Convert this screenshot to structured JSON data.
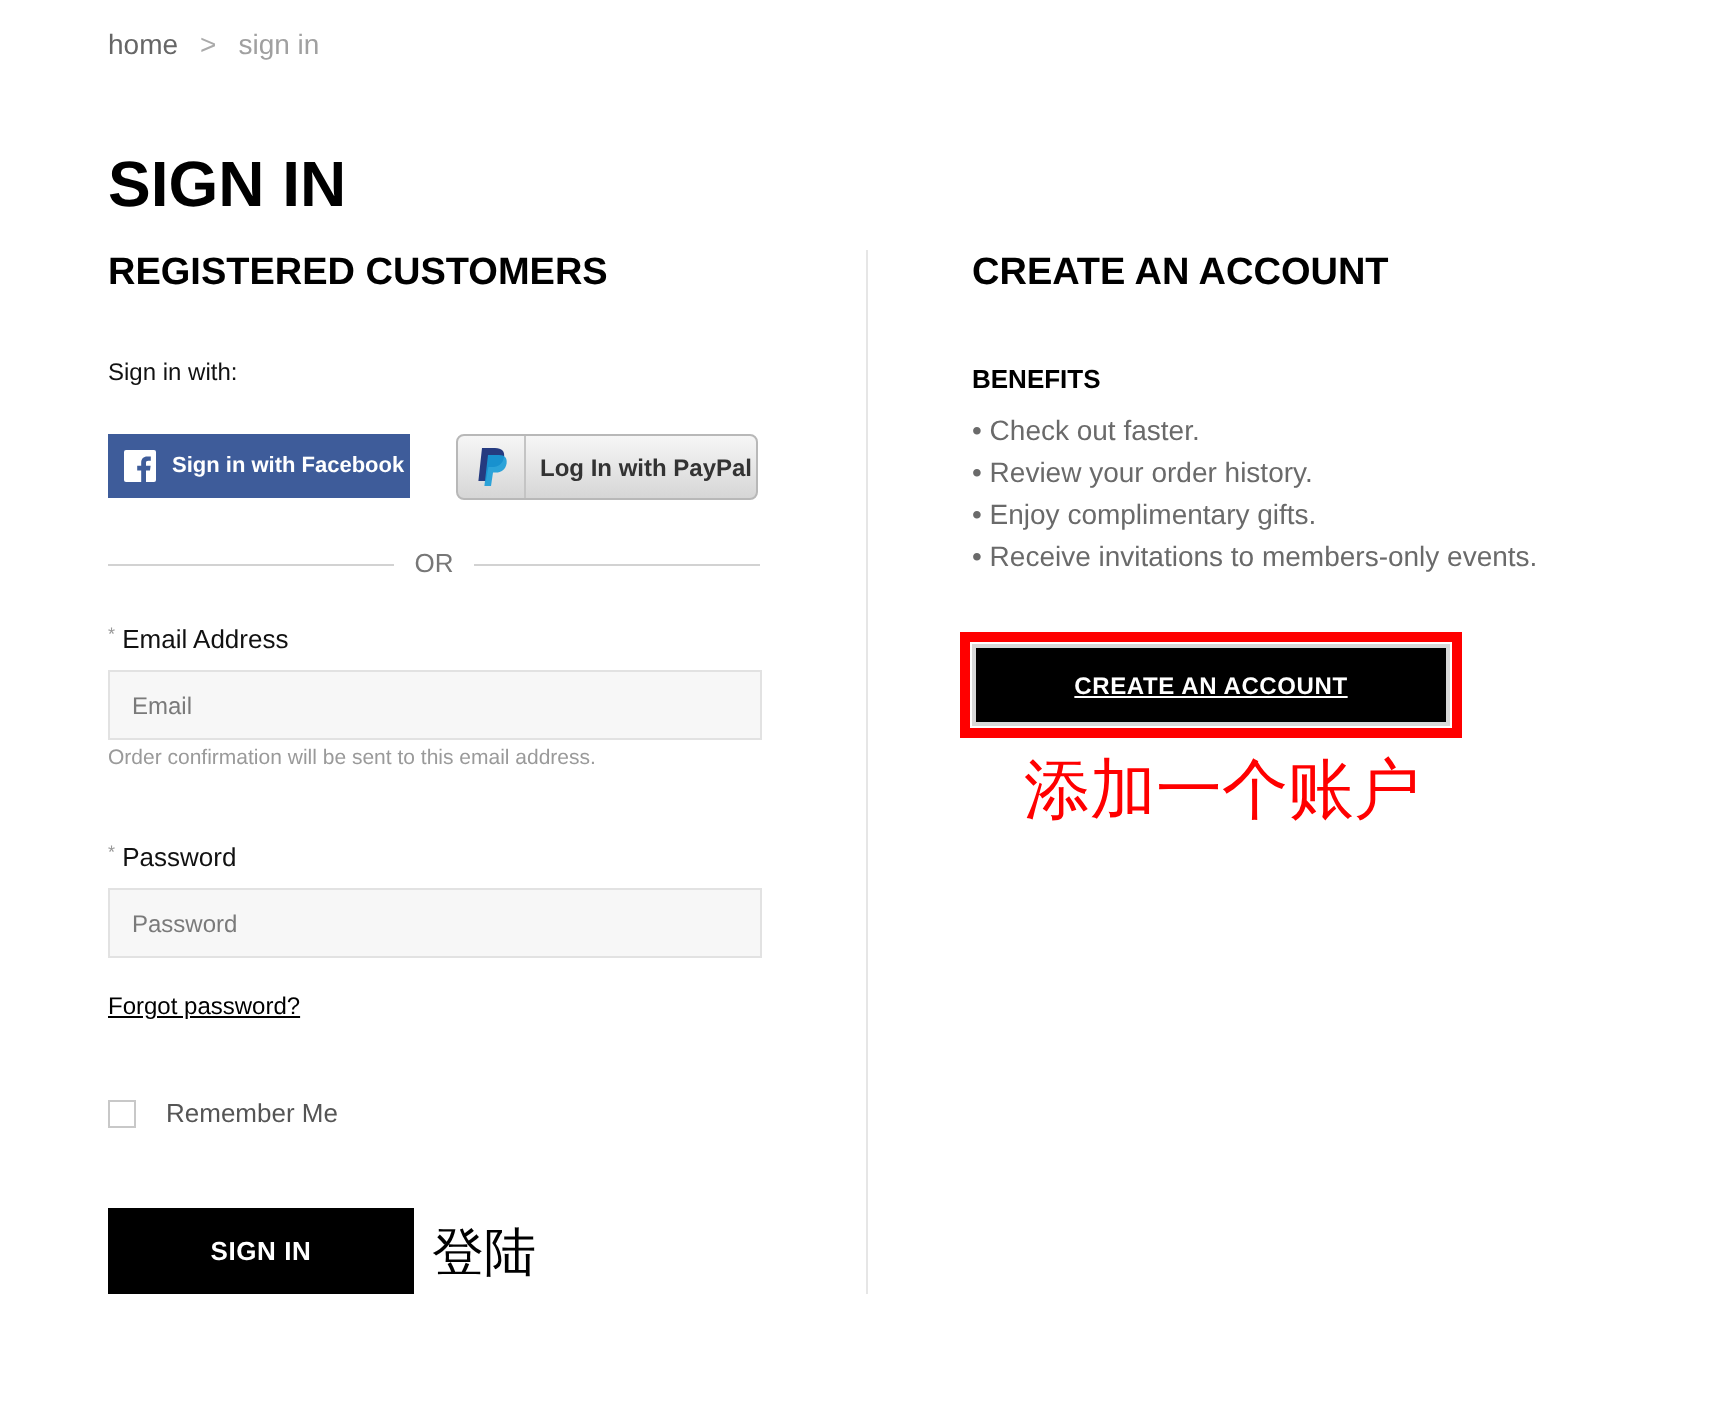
{
  "breadcrumb": {
    "separator": ">",
    "items": [
      {
        "label": "home",
        "current": false
      },
      {
        "label": "sign in",
        "current": true
      }
    ]
  },
  "page_title": "SIGN IN",
  "sign_in": {
    "heading": "REGISTERED CUSTOMERS",
    "social_label": "Sign in with:",
    "social_buttons": [
      {
        "kind": "facebook",
        "label": "Sign in with Facebook"
      },
      {
        "kind": "paypal",
        "label": "Log In with PayPal"
      }
    ],
    "divider_label": "OR",
    "fields": [
      {
        "label": "$^{*}$ Email Address",
        "placeholder": "Email",
        "hint": "Order confirmation will be sent to this email address."
      },
      {
        "label": "$^{*}$ Password",
        "placeholder": "Password"
      }
    ],
    "forgot_link": "Forgot password?",
    "remember_me": {
      "label": "Remember Me",
      "checked": false
    },
    "submit_button": "SIGN IN",
    "annotation": "登陆"
  },
  "create_account": {
    "heading": "CREATE AN ACCOUNT",
    "benefits_heading": "BENEFITS",
    "benefits": [
      "• Check out faster.",
      "• Review your order history.",
      "• Enjoy complimentary gifts.",
      "• Receive invitations to members-only events."
    ],
    "button": {
      "label": "CREATE AN ACCOUNT",
      "highlighted": true
    },
    "annotation": "添加一个账户"
  }
}
